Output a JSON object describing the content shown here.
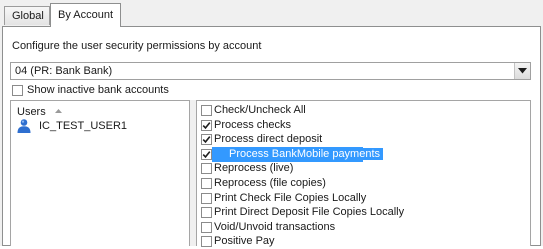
{
  "tabs": [
    {
      "label": "Global",
      "active": false
    },
    {
      "label": "By Account",
      "active": true
    }
  ],
  "description": "Configure the user security permissions by account",
  "account_combo": {
    "value": "04 (PR: Bank Bank)"
  },
  "show_inactive": {
    "label": "Show inactive bank accounts",
    "checked": false
  },
  "users": {
    "header": "Users",
    "items": [
      {
        "name": "IC_TEST_USER1"
      }
    ]
  },
  "permissions": [
    {
      "label": "Check/Uncheck All",
      "checked": false,
      "selected": false
    },
    {
      "label": "Process checks",
      "checked": true,
      "selected": false
    },
    {
      "label": "Process direct deposit",
      "checked": true,
      "selected": false
    },
    {
      "label": "Process BankMobile payments",
      "checked": true,
      "selected": true
    },
    {
      "label": "Reprocess (live)",
      "checked": false,
      "selected": false
    },
    {
      "label": "Reprocess (file copies)",
      "checked": false,
      "selected": false
    },
    {
      "label": "Print Check File Copies Locally",
      "checked": false,
      "selected": false
    },
    {
      "label": "Print Direct Deposit File Copies Locally",
      "checked": false,
      "selected": false
    },
    {
      "label": "Void/Unvoid transactions",
      "checked": false,
      "selected": false
    },
    {
      "label": "Positive Pay",
      "checked": false,
      "selected": false
    }
  ],
  "colors": {
    "selection": "#3399ff",
    "user_icon": "#2e6fd0"
  }
}
